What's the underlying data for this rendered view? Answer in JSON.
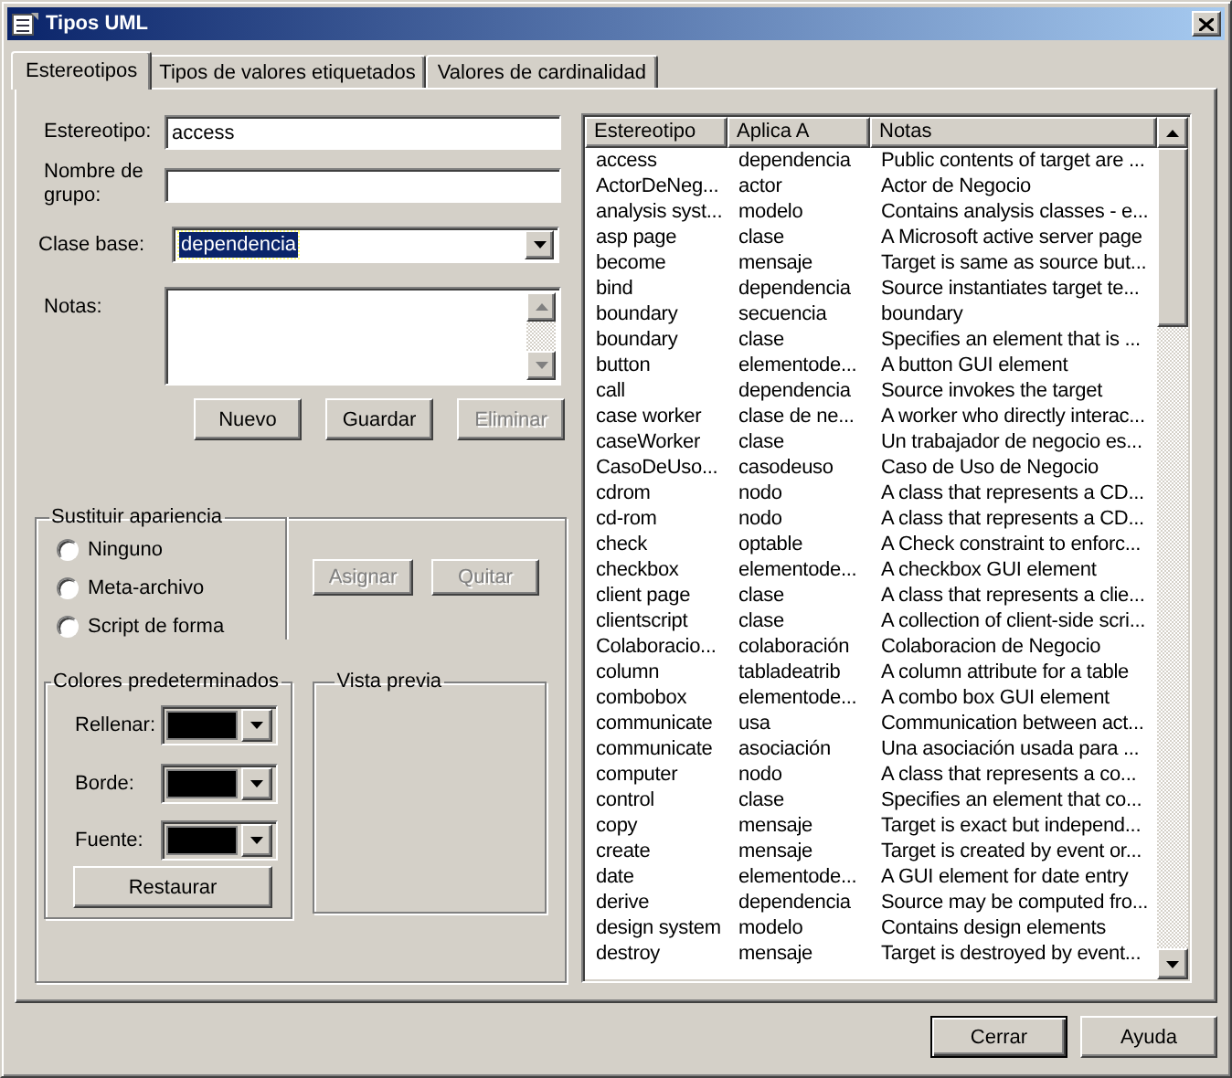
{
  "window": {
    "title": "Tipos UML"
  },
  "tabs": [
    {
      "label": "Estereotipos",
      "selected": true
    },
    {
      "label": "Tipos de valores etiquetados",
      "selected": false
    },
    {
      "label": "Valores de cardinalidad",
      "selected": false
    }
  ],
  "form": {
    "fields": [
      {
        "kind": "text",
        "label": "Estereotipo:",
        "value": "access"
      },
      {
        "kind": "text",
        "label": "Nombre de grupo:"
      },
      {
        "kind": "select",
        "label": "Clase base:",
        "value": "dependencia",
        "highlighted": true
      },
      {
        "kind": "textarea",
        "label": "Notas:"
      }
    ],
    "buttons": [
      {
        "label": "Nuevo",
        "disabled": false
      },
      {
        "label": "Guardar",
        "disabled": false
      },
      {
        "label": "Eliminar",
        "disabled": true
      }
    ]
  },
  "appearance": {
    "title": "Sustituir apariencia",
    "options": [
      {
        "label": "Ninguno",
        "selected": false
      },
      {
        "label": "Meta-archivo",
        "selected": false
      },
      {
        "label": "Script de forma",
        "selected": false
      }
    ],
    "buttons": [
      {
        "label": "Asignar",
        "disabled": true
      },
      {
        "label": "Quitar",
        "disabled": true
      }
    ]
  },
  "default_colors": {
    "title": "Colores predeterminados",
    "pickers": [
      {
        "label": "Rellenar:",
        "color": "#000000"
      },
      {
        "label": "Borde:",
        "color": "#000000"
      },
      {
        "label": "Fuente:",
        "color": "#000000"
      }
    ],
    "reset_button": "Restaurar"
  },
  "preview": {
    "title": "Vista previa"
  },
  "table": {
    "columns": [
      "Estereotipo",
      "Aplica A",
      "Notas"
    ],
    "rows": [
      [
        "access",
        "dependencia",
        "Public contents of target are ..."
      ],
      [
        "ActorDeNeg...",
        "actor",
        "Actor de Negocio"
      ],
      [
        "analysis syst...",
        "modelo",
        "Contains analysis classes - e..."
      ],
      [
        "asp page",
        "clase",
        "A Microsoft active server page"
      ],
      [
        "become",
        "mensaje",
        "Target is same as source but..."
      ],
      [
        "bind",
        "dependencia",
        "Source instantiates target te..."
      ],
      [
        "boundary",
        "secuencia",
        "boundary"
      ],
      [
        "boundary",
        "clase",
        "Specifies an element that is ..."
      ],
      [
        "button",
        "elementode...",
        "A button GUI element"
      ],
      [
        "call",
        "dependencia",
        "Source invokes the target"
      ],
      [
        "case worker",
        "clase de ne...",
        "A worker who directly interac..."
      ],
      [
        "caseWorker",
        "clase",
        "Un trabajador de negocio es..."
      ],
      [
        "CasoDeUso...",
        "casodeuso",
        "Caso de Uso de Negocio"
      ],
      [
        "cdrom",
        "nodo",
        "A class that represents a CD..."
      ],
      [
        "cd-rom",
        "nodo",
        "A class that represents a CD..."
      ],
      [
        "check",
        "optable",
        "A Check constraint to enforc..."
      ],
      [
        "checkbox",
        "elementode...",
        "A checkbox GUI element"
      ],
      [
        "client page",
        "clase",
        "A class that represents a clie..."
      ],
      [
        "clientscript",
        "clase",
        "A collection of client-side scri..."
      ],
      [
        "Colaboracio...",
        "colaboración",
        "Colaboracion de Negocio"
      ],
      [
        "column",
        "tabladeatrib",
        "A column attribute for a table"
      ],
      [
        "combobox",
        "elementode...",
        "A combo box GUI element"
      ],
      [
        "communicate",
        "usa",
        "Communication between act..."
      ],
      [
        "communicate",
        "asociación",
        "Una asociación usada para ..."
      ],
      [
        "computer",
        "nodo",
        "A class that represents a co..."
      ],
      [
        "control",
        "clase",
        "Specifies an element that co..."
      ],
      [
        "copy",
        "mensaje",
        "Target is exact but independ..."
      ],
      [
        "create",
        "mensaje",
        "Target is created by event or..."
      ],
      [
        "date",
        "elementode...",
        "A GUI element for date entry"
      ],
      [
        "derive",
        "dependencia",
        "Source may be computed fro..."
      ],
      [
        "design system",
        "modelo",
        "Contains design elements"
      ],
      [
        "destroy",
        "mensaje",
        "Target is destroyed by event..."
      ]
    ]
  },
  "footer_buttons": [
    {
      "label": "Cerrar",
      "default": true
    },
    {
      "label": "Ayuda",
      "default": false
    }
  ]
}
